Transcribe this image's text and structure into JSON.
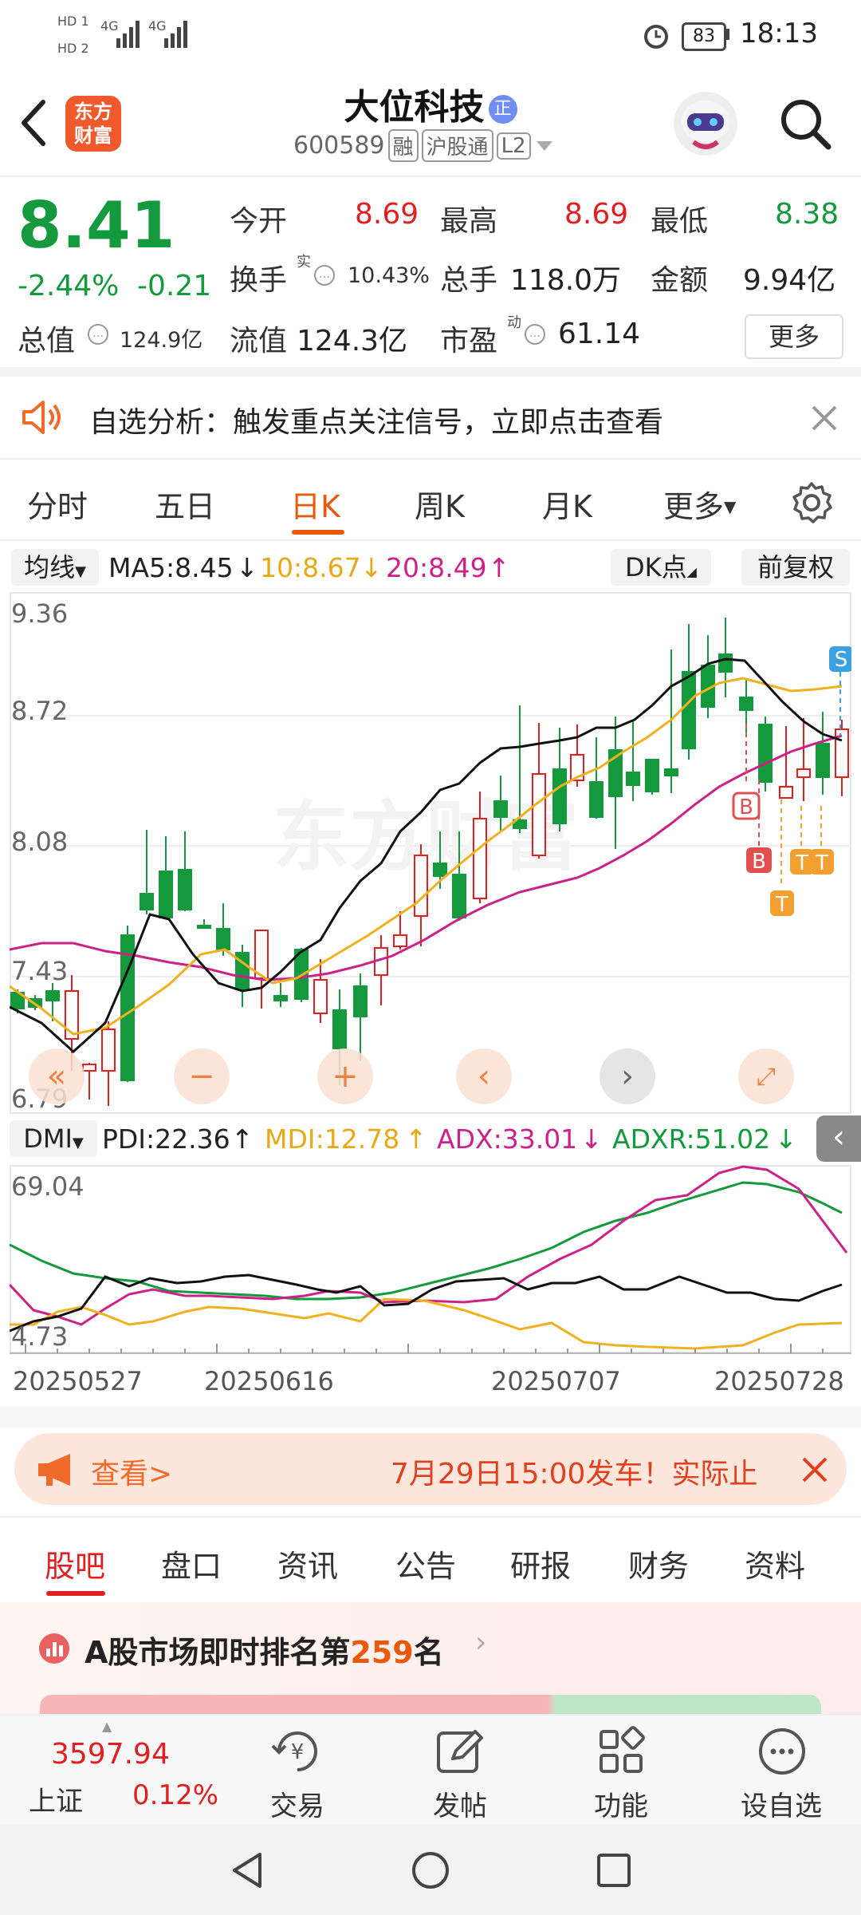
{
  "status": {
    "sim1": "HD 1",
    "sim2": "HD 2",
    "net1": "4G",
    "net2": "4G",
    "battery": "83",
    "time": "18:13"
  },
  "header": {
    "logo_line1": "东方",
    "logo_line2": "财富",
    "title": "大位科技",
    "title_badge": "正",
    "code": "600589",
    "tags": [
      "融",
      "沪股通",
      "L2"
    ]
  },
  "quote": {
    "price": "8.41",
    "change_pct": "-2.44%",
    "change": "-0.21",
    "rows": [
      [
        {
          "label": "今开",
          "value": "8.69",
          "color": "red"
        },
        {
          "label": "最高",
          "value": "8.69",
          "color": "red"
        },
        {
          "label": "最低",
          "value": "8.38",
          "color": "green"
        }
      ],
      [
        {
          "label": "换手",
          "sup": "实",
          "value": "10.43%"
        },
        {
          "label": "总手",
          "value": "118.0万"
        },
        {
          "label": "金额",
          "value": "9.94亿"
        }
      ]
    ],
    "market_cap_label": "总值",
    "market_cap": "124.9亿",
    "float_label": "流值",
    "float_value": "124.3亿",
    "pe_label": "市盈",
    "pe_sup": "动",
    "pe_value": "61.14",
    "more": "更多"
  },
  "alert": {
    "text": "自选分析：触发重点关注信号，立即点击查看"
  },
  "tabs": {
    "items": [
      "分时",
      "五日",
      "日K",
      "周K",
      "月K",
      "更多"
    ],
    "active": "日K"
  },
  "kline": {
    "ma_chip": "均线",
    "ma5": "MA5:8.45",
    "ma10": "10:8.67",
    "ma20": "20:8.49",
    "dk_chip": "DK点",
    "adjust": "前复权",
    "y_labels": [
      "9.36",
      "8.72",
      "8.08",
      "7.43",
      "6.79"
    ],
    "watermark": "东方财富",
    "colors": {
      "up": "#e02020",
      "down": "#149a3c",
      "ma5": "#111111",
      "ma10": "#f0b020",
      "ma20": "#cc2288"
    }
  },
  "dmi": {
    "chip": "DMI",
    "pdi": "PDI:22.36",
    "mdi": "MDI:12.78",
    "adx": "ADX:33.01",
    "adxr": "ADXR:51.02",
    "y_top": "69.04",
    "y_bottom": "4.73",
    "dates": [
      "20250527",
      "20250616",
      "20250707",
      "20250728"
    ]
  },
  "banner": {
    "link": "查看>",
    "text": "7月29日15:00发车！实际止"
  },
  "news_tabs": {
    "items": [
      "股吧",
      "盘口",
      "资讯",
      "公告",
      "研报",
      "财务",
      "资料"
    ],
    "active": "股吧"
  },
  "ranking": {
    "prefix": "A股市场即时排名第",
    "rank": "259",
    "suffix": "名"
  },
  "bottom": {
    "index_value": "3597.94",
    "index_name": "上证",
    "index_change": "0.12%",
    "items": [
      "交易",
      "发帖",
      "功能",
      "设自选"
    ]
  }
}
